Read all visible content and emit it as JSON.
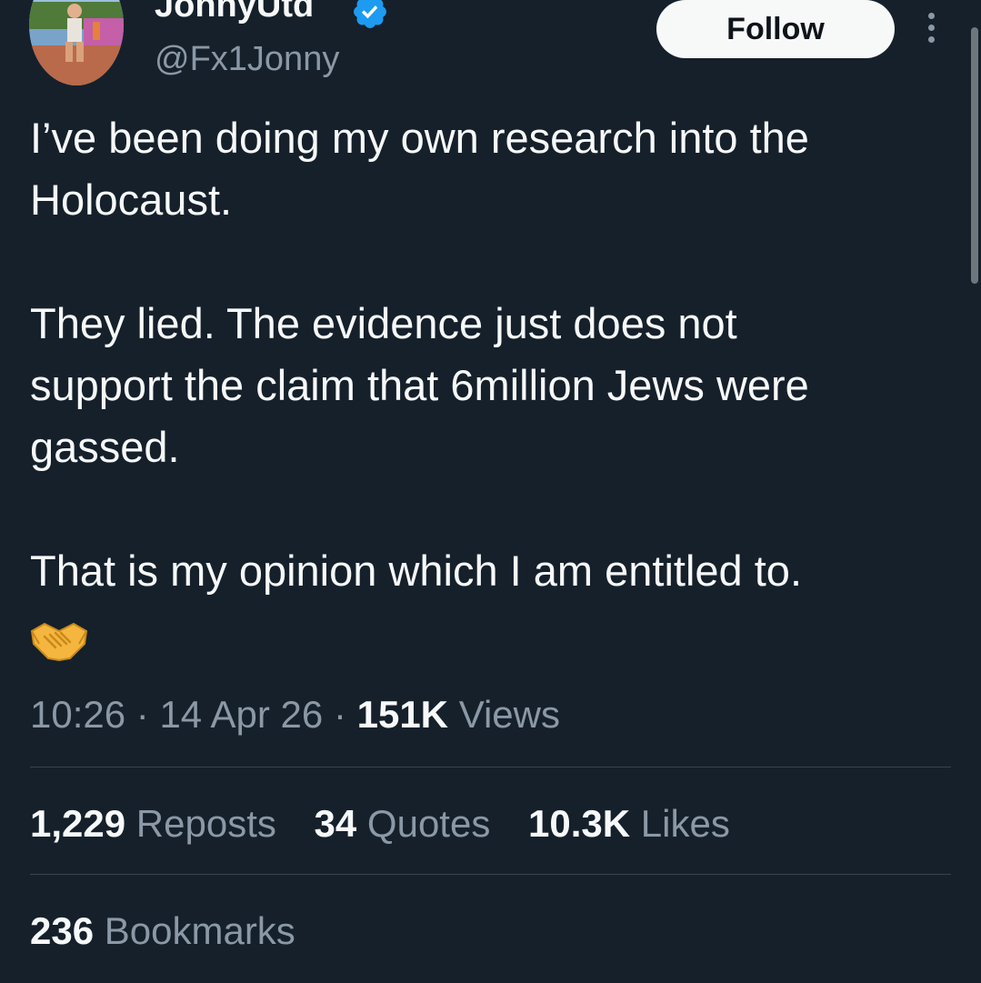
{
  "author": {
    "display_name": "JonnyUtd",
    "handle": "@Fx1Jonny",
    "verified": true
  },
  "follow_label": "Follow",
  "tweet": {
    "text": "I’ve been doing my own research into the\nHolocaust.\n\nThey lied. The evidence just does not\nsupport the claim that 6million Jews were\ngassed.\n\nThat is my opinion which I am entitled to.",
    "emoji": "handshake-emoji"
  },
  "meta": {
    "time": "10:26",
    "date": "14 Apr 26",
    "views_count": "151K",
    "views_label": "Views",
    "separator": "·"
  },
  "stats": {
    "reposts_count": "1,229",
    "reposts_label": "Reposts",
    "quotes_count": "34",
    "quotes_label": "Quotes",
    "likes_count": "10.3K",
    "likes_label": "Likes",
    "bookmarks_count": "236",
    "bookmarks_label": "Bookmarks"
  },
  "colors": {
    "background": "#15202b",
    "text_primary": "#f7f9f9",
    "text_secondary": "#8b98a5",
    "divider": "#38444d",
    "verified_badge": "#1d9bf0",
    "follow_button_bg": "#f7f9f9"
  }
}
